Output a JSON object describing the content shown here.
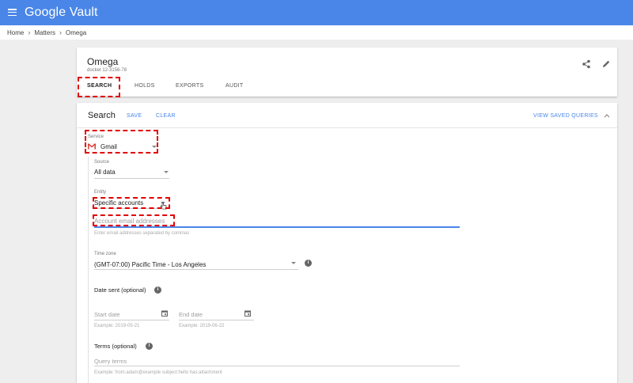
{
  "app": {
    "title": "Google Vault"
  },
  "breadcrumb": {
    "items": [
      "Home",
      "Matters",
      "Omega"
    ]
  },
  "matter": {
    "title": "Omega",
    "id": "docket 12-3156-78",
    "tabs": [
      "SEARCH",
      "HOLDS",
      "EXPORTS",
      "AUDIT"
    ]
  },
  "search": {
    "title": "Search",
    "save_label": "SAVE",
    "clear_label": "CLEAR",
    "view_saved_label": "VIEW SAVED QUERIES",
    "service": {
      "label": "Service",
      "value": "Gmail"
    },
    "source": {
      "label": "Source",
      "value": "All data"
    },
    "entity": {
      "label": "Entity",
      "value": "Specific accounts"
    },
    "accounts": {
      "placeholder": "Account email addresses",
      "hint": "Enter email addresses separated by commas"
    },
    "timezone": {
      "label": "Time zone",
      "value": "(GMT-07:00) Pacific Time - Los Angeles"
    },
    "date_sent": {
      "label": "Date sent (optional)",
      "start_placeholder": "Start date",
      "end_placeholder": "End date",
      "start_example": "Example: 2019-05-21",
      "end_example": "Example: 2019-06-22"
    },
    "terms": {
      "label": "Terms (optional)",
      "placeholder": "Query terms",
      "hint": "Example: from:adam@example subject:hello has:attachment"
    }
  },
  "icons": {
    "menu": "hamburger-icon",
    "share": "share-icon",
    "edit": "pencil-icon",
    "collapse": "chevron-up-icon",
    "gmail": "gmail-icon",
    "info": "info-icon",
    "calendar": "calendar-icon",
    "cursor": "hand-cursor-icon"
  },
  "colors": {
    "brand": "#4a86e8",
    "highlight": "#e00000"
  }
}
